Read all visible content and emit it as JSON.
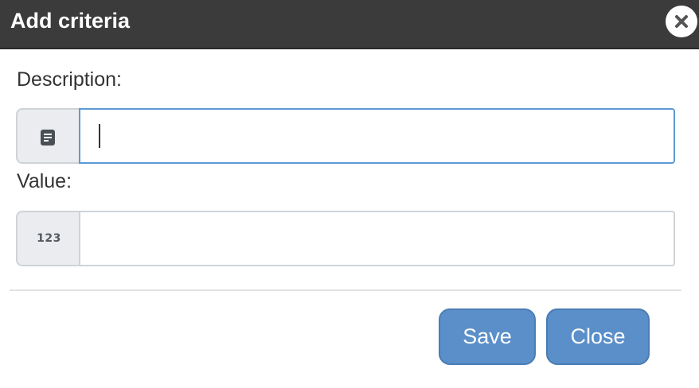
{
  "dialog": {
    "title": "Add criteria",
    "close_icon": "close-x-icon"
  },
  "form": {
    "description": {
      "label": "Description:",
      "icon": "note-icon",
      "value": "",
      "focused": true
    },
    "value": {
      "label": "Value:",
      "addon_text": "123",
      "value": ""
    }
  },
  "buttons": {
    "save_label": "Save",
    "close_label": "Close"
  },
  "colors": {
    "titlebar": "#3b3b3b",
    "button": "#5b8fc9",
    "focus_border": "#5b9ad6"
  }
}
